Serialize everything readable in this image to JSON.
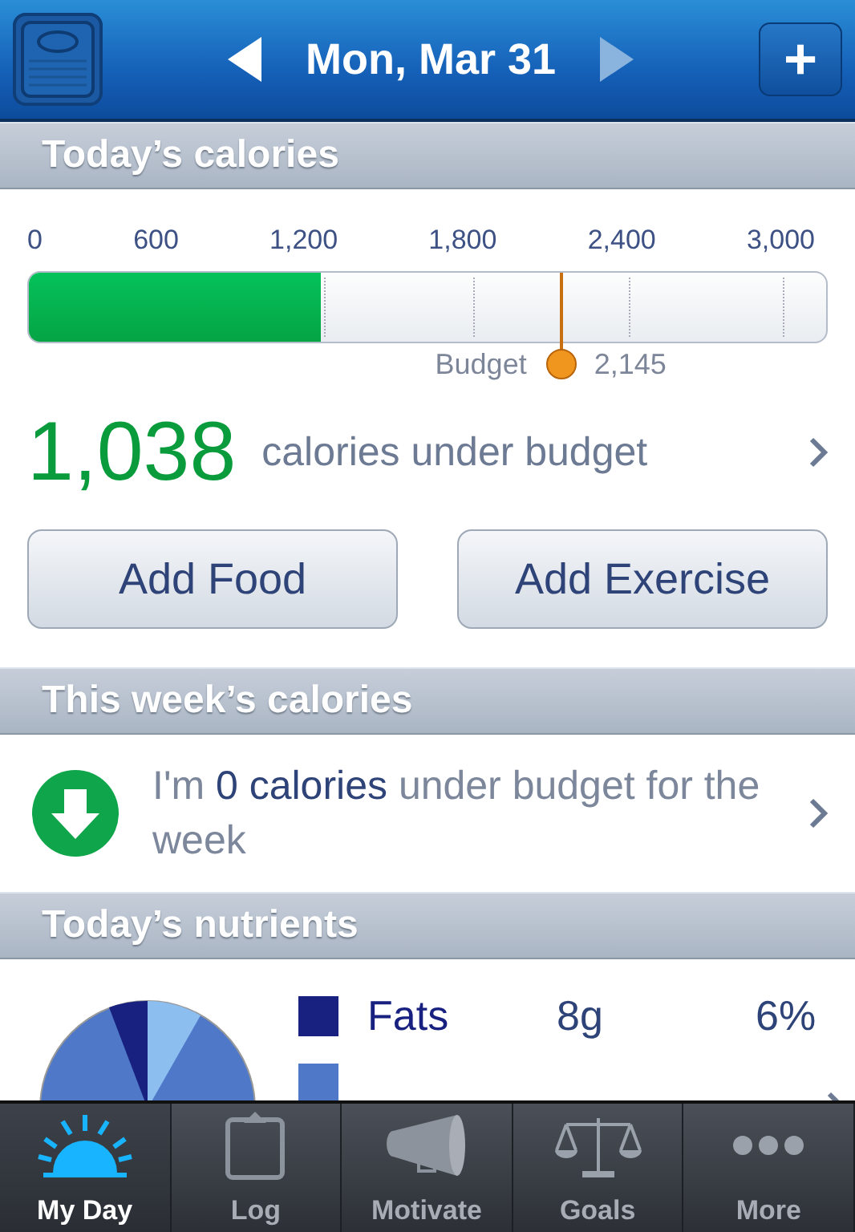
{
  "header": {
    "date": "Mon, Mar 31",
    "add_symbol": "+"
  },
  "today": {
    "title": "Today’s calories",
    "scale": [
      "0",
      "600",
      "1,200",
      "1,800",
      "2,400",
      "3,000"
    ],
    "consumed": {
      "level": 0.366
    },
    "budget_marker": {
      "level": 0.668
    },
    "budget_label": "Budget",
    "budget_value": "2,145",
    "remaining": "1,038",
    "remaining_text": "calories under budget",
    "buttons": [
      "Add Food",
      "Add Exercise"
    ]
  },
  "week": {
    "title": "This week’s calories",
    "message": "I'm **0 calories** under budget for the week"
  },
  "nutrients": {
    "title": "Today’s nutrients",
    "rows": [
      {
        "name": "Fats",
        "amount": "8g",
        "percent": "6%",
        "color": "#18217f"
      },
      {
        "color": "#4f78c8"
      }
    ]
  },
  "tabs": [
    {
      "label": "My Day",
      "selected": true
    },
    {
      "label": "Log",
      "selected": false
    },
    {
      "label": "Motivate",
      "selected": false
    },
    {
      "label": "Goals",
      "selected": false
    },
    {
      "label": "More",
      "selected": false
    }
  ]
}
